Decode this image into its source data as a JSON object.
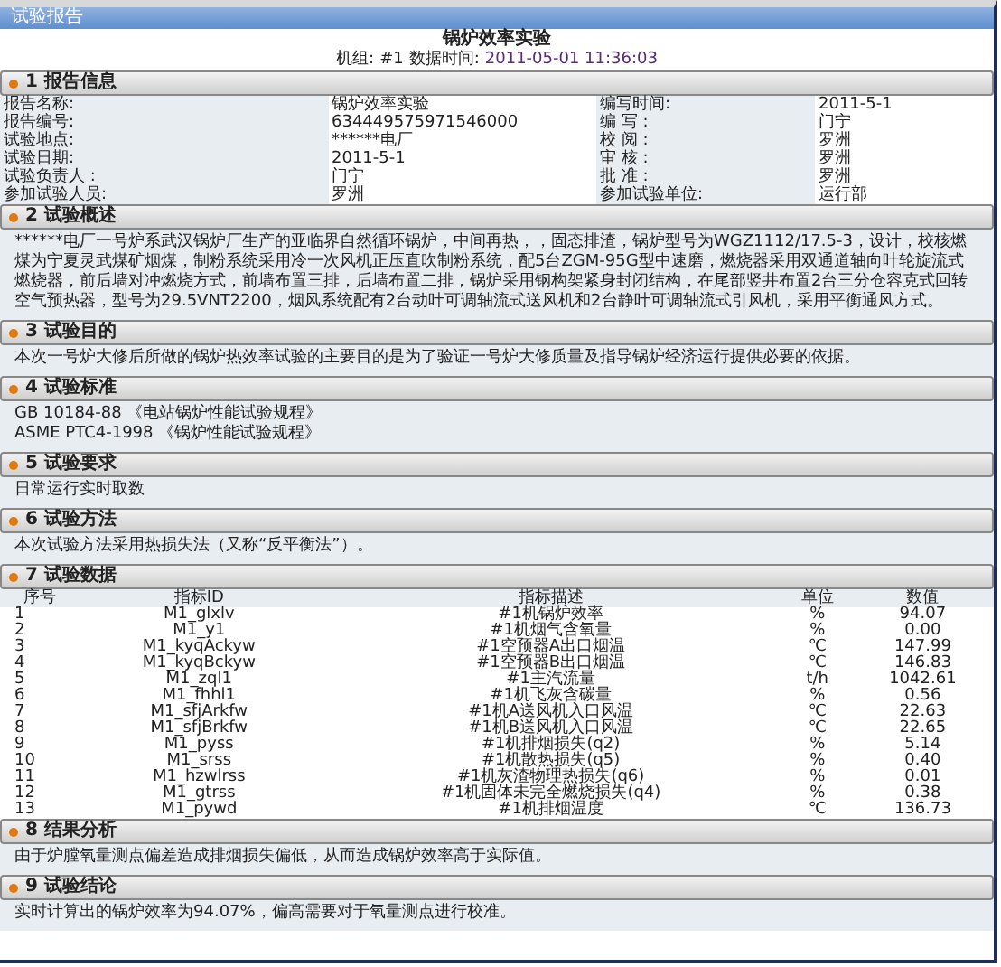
{
  "window": {
    "title": "试验报告"
  },
  "report": {
    "title": "锅炉效率实验",
    "unit_label": "机组:",
    "unit": "#1",
    "time_label": "数据时间:",
    "time": "2011-05-01 11:36:03"
  },
  "sections": [
    {
      "number": "1",
      "title": "报告信息",
      "kind": "info",
      "rows": [
        {
          "label": "报告名称:",
          "value": "锅炉效率实验",
          "label2": "编写时间:",
          "value2": "2011-5-1"
        },
        {
          "label": "报告编号:",
          "value": "634449575971546000",
          "label2": "编 写 :",
          "value2": "门宁"
        },
        {
          "label": "试验地点:",
          "value": "******电厂",
          "label2": "校 阅 :",
          "value2": "罗洲"
        },
        {
          "label": "试验日期:",
          "value": "2011-5-1",
          "label2": "审 核 :",
          "value2": "罗洲"
        },
        {
          "label": "试验负责人 :",
          "value": "门宁",
          "label2": "批 准 :",
          "value2": "罗洲"
        },
        {
          "label": "参加试验人员:",
          "value": "罗洲",
          "label2": "参加试验单位:",
          "value2": "运行部"
        }
      ]
    },
    {
      "number": "2",
      "title": "试验概述",
      "kind": "text",
      "lines": [
        "******电厂一号炉系武汉锅炉厂生产的亚临界自然循环锅炉，中间再热，，固态排渣，锅炉型号为WGZ1112/17.5-3，设计，校核燃煤为宁夏灵武煤矿烟煤，制粉系统采用冷一次风机正压直吹制粉系统，配5台ZGM-95G型中速磨，燃烧器采用双通道轴向叶轮旋流式燃烧器，前后墙对冲燃烧方式，前墙布置三排，后墙布置二排，锅炉采用钢构架紧身封闭结构，在尾部竖井布置2台三分仓容克式回转空气预热器，型号为29.5VNT2200，烟风系统配有2台动叶可调轴流式送风机和2台静叶可调轴流式引风机，采用平衡通风方式。"
      ]
    },
    {
      "number": "3",
      "title": "试验目的",
      "kind": "text",
      "lines": [
        "本次一号炉大修后所做的锅炉热效率试验的主要目的是为了验证一号炉大修质量及指导锅炉经济运行提供必要的依据。"
      ]
    },
    {
      "number": "4",
      "title": "试验标准",
      "kind": "text",
      "lines": [
        "GB 10184-88 《电站锅炉性能试验规程》",
        "ASME PTC4-1998 《锅炉性能试验规程》"
      ]
    },
    {
      "number": "5",
      "title": "试验要求",
      "kind": "text",
      "lines": [
        "日常运行实时取数"
      ]
    },
    {
      "number": "6",
      "title": "试验方法",
      "kind": "text",
      "lines": [
        "本次试验方法采用热损失法（又称“反平衡法”）。"
      ]
    },
    {
      "number": "7",
      "title": "试验数据",
      "kind": "table",
      "columns": [
        "序号",
        "指标ID",
        "指标描述",
        "单位",
        "数值"
      ],
      "rows": [
        [
          "1",
          "M1_glxlv",
          "#1机锅炉效率",
          "%",
          "94.07"
        ],
        [
          "2",
          "M1_y1",
          "#1机烟气含氧量",
          "%",
          "0.00"
        ],
        [
          "3",
          "M1_kyqAckyw",
          "#1空预器A出口烟温",
          "℃",
          "147.99"
        ],
        [
          "4",
          "M1_kyqBckyw",
          "#1空预器B出口烟温",
          "℃",
          "146.83"
        ],
        [
          "5",
          "M1_zql1",
          "#1主汽流量",
          "t/h",
          "1042.61"
        ],
        [
          "6",
          "M1_fhhl1",
          "#1机飞灰含碳量",
          "%",
          "0.56"
        ],
        [
          "7",
          "M1_sfjArkfw",
          "#1机A送风机入口风温",
          "℃",
          "22.63"
        ],
        [
          "8",
          "M1_sfjBrkfw",
          "#1机B送风机入口风温",
          "℃",
          "22.65"
        ],
        [
          "9",
          "M1_pyss",
          "#1机排烟损失(q2)",
          "%",
          "5.14"
        ],
        [
          "10",
          "M1_srss",
          "#1机散热损失(q5)",
          "%",
          "0.40"
        ],
        [
          "11",
          "M1_hzwlrss",
          "#1机灰渣物理热损失(q6)",
          "%",
          "0.01"
        ],
        [
          "12",
          "M1_gtrss",
          "#1机固体未完全燃烧损失(q4)",
          "%",
          "0.38"
        ],
        [
          "13",
          "M1_pywd",
          "#1机排烟温度",
          "℃",
          "136.73"
        ]
      ]
    },
    {
      "number": "8",
      "title": "结果分析",
      "kind": "text",
      "lines": [
        "由于炉膛氧量测点偏差造成排烟损失偏低，从而造成锅炉效率高于实际值。"
      ]
    },
    {
      "number": "9",
      "title": "试验结论",
      "kind": "text",
      "lines": [
        "实时计算出的锅炉效率为94.07%，偏高需要对于氧量测点进行校准。"
      ]
    }
  ]
}
